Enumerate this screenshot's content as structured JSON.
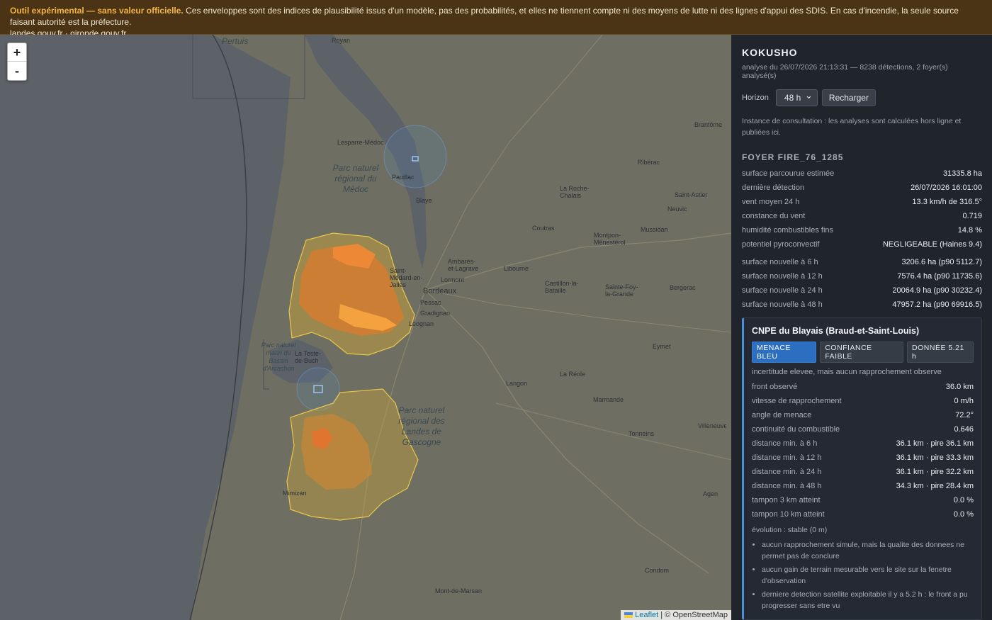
{
  "banner": {
    "strong": "Outil expérimental — sans valeur officielle.",
    "text": " Ces enveloppes sont des indices de plausibilité issus d'un modèle, pas des probabilités, et elles ne tiennent compte ni des moyens de lutte ni des lignes d'appui des SDIS. En cas d'incendie, la seule source faisant autorité est la préfecture.",
    "link1": "landes.gouv.fr",
    "sep": " · ",
    "link2": "gironde.gouv.fr"
  },
  "map": {
    "zoom_in": "+",
    "zoom_out": "-",
    "attribution_leaflet": "Leaflet",
    "attribution_rest": " | © OpenStreetMap",
    "labels": [
      "Royan",
      "Lesparre-Médoc",
      "Pauillac",
      "Blaye",
      "Ambarès-et-Lagrave",
      "Libourne",
      "Saint-Médard-en-Jalles",
      "Bordeaux",
      "Pessac",
      "Gradignan",
      "Léognan",
      "Lormont",
      "Coutras",
      "La Roche-Chalais",
      "Ribérac",
      "Montpon-Ménestérol",
      "Mussidan",
      "Castillon-la-Bataille",
      "Sainte-Foy-la-Grande",
      "Bergerac",
      "Eymet",
      "La Réole",
      "Langon",
      "Marmande",
      "Tonneins",
      "Condom",
      "Mont-de-Marsan",
      "Mimizan",
      "La Teste-de-Buch",
      "Brantôme",
      "Saint-Astier",
      "Neuvic",
      "Agen",
      "Villeneuve"
    ],
    "park_labels": [
      "Pertuis",
      "Parc naturel régional du Médoc",
      "Parc naturel régional des Landes de Gascogne",
      "Parc naturel marin du Bassin d'Arcachon"
    ]
  },
  "panel": {
    "title": "KOKUSHO",
    "subtitle": "analyse du 26/07/2026 21:13:31 — 8238 détections, 2 foyer(s) analysé(s)",
    "horizon_label": "Horizon",
    "horizon_value": "48 h",
    "reload_label": "Recharger",
    "info": "Instance de consultation : les analyses sont calculées hors ligne et publiées ici.",
    "foyer_title": "FOYER FIRE_76_1285",
    "foyer_rows": [
      {
        "k": "surface parcourue estimée",
        "v": "31335.8 ha"
      },
      {
        "k": "dernière détection",
        "v": "26/07/2026 16:01:00"
      },
      {
        "k": "vent moyen 24 h",
        "v": "13.3 km/h de 316.5°"
      },
      {
        "k": "constance du vent",
        "v": "0.719"
      },
      {
        "k": "humidité combustibles fins",
        "v": "14.8 %"
      },
      {
        "k": "potentiel pyroconvectif",
        "v": "NEGLIGEABLE (Haines 9.4)"
      }
    ],
    "surface_rows": [
      {
        "k": "surface nouvelle à 6 h",
        "v": "3206.6 ha (p90 5112.7)"
      },
      {
        "k": "surface nouvelle à 12 h",
        "v": "7576.4 ha (p90 11735.6)"
      },
      {
        "k": "surface nouvelle à 24 h",
        "v": "20064.9 ha (p90 30232.4)"
      },
      {
        "k": "surface nouvelle à 48 h",
        "v": "47957.2 ha (p90 69916.5)"
      }
    ],
    "site": {
      "title": "CNPE du Blayais (Braud-et-Saint-Louis)",
      "badges": [
        "MENACE BLEU",
        "CONFIANCE FAIBLE",
        "DONNÉE 5.21 h"
      ],
      "note": "incertitude elevee, mais aucun rapprochement observe",
      "rows": [
        {
          "k": "front observé",
          "v": "36.0 km"
        },
        {
          "k": "vitesse de rapprochement",
          "v": "0 m/h"
        },
        {
          "k": "angle de menace",
          "v": "72.2°"
        },
        {
          "k": "continuité du combustible",
          "v": "0.646"
        },
        {
          "k": "distance min. à 6 h",
          "v": "36.1 km · pire 36.1 km"
        },
        {
          "k": "distance min. à 12 h",
          "v": "36.1 km · pire 33.3 km"
        },
        {
          "k": "distance min. à 24 h",
          "v": "36.1 km · pire 32.2 km"
        },
        {
          "k": "distance min. à 48 h",
          "v": "34.3 km · pire 28.4 km"
        },
        {
          "k": "tampon 3 km atteint",
          "v": "0.0 %"
        },
        {
          "k": "tampon 10 km atteint",
          "v": "0.0 %"
        }
      ],
      "evolution": "évolution : stable (0 m)",
      "bullets": [
        "aucun rapprochement simule, mais la qualite des donnees ne permet pas de conclure",
        "aucun gain de terrain mesurable vers le site sur la fenetre d'observation",
        "derniere detection satellite exploitable il y a 5.2 h : le front a pu progresser sans etre vu"
      ]
    }
  }
}
